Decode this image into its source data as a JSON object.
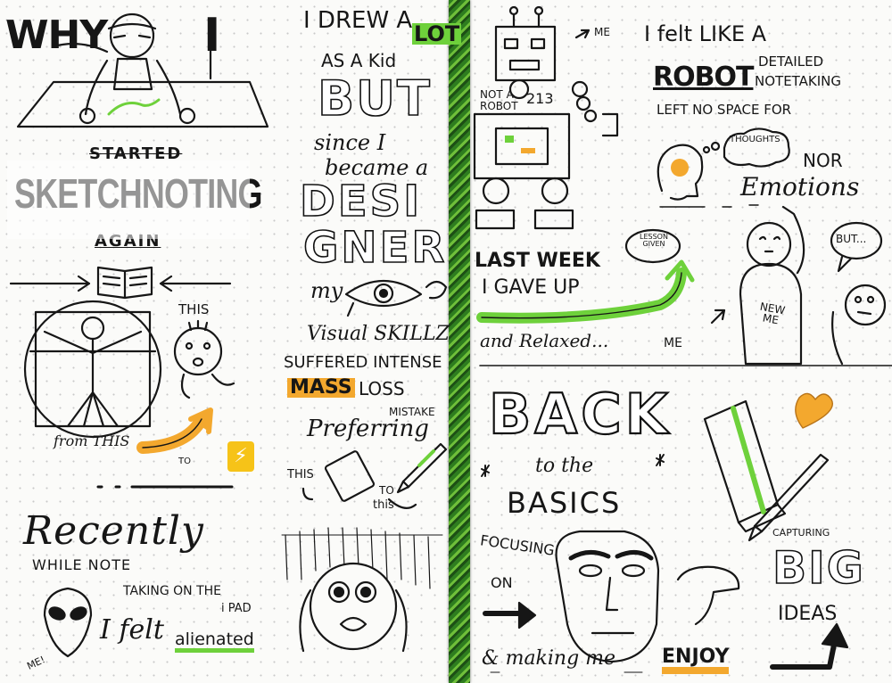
{
  "left_page": {
    "title_why": "WHY",
    "title_i": "I",
    "started": "STARTED",
    "sketchnoting": "SKETCHNOTING",
    "again": "AGAIN",
    "this_label": "THIS",
    "from_this": "from THIS",
    "to_small": "TO",
    "recently": "Recently",
    "while_note": "WHILE NOTE",
    "taking_on_the": "TAKING ON THE",
    "ipad": "i PAD",
    "i_felt": "I felt",
    "alienated": "alienated",
    "me_small": "ME!",
    "i_drew_a": "I DREW A",
    "lot": "LOT",
    "as_a_kid": "AS A Kid",
    "but": "BUT",
    "since_i": "since I",
    "became_a": "became a",
    "desi": "DESI",
    "gner": "GNER",
    "my": "my",
    "visual_skillz": "Visual SKILLZ",
    "suffered_intense": "SUFFERED INTENSE",
    "mass": "MASS",
    "loss": "LOSS",
    "mistake": "MISTAKE",
    "preferring": "Preferring",
    "this_small": "THIS",
    "to_this": "TO",
    "this_end": "this"
  },
  "right_page": {
    "me_label": "ME",
    "not_a_robot": "NOT A",
    "robot_word": "ROBOT",
    "robot_num": "213",
    "i_felt_like_a": "I felt LIKE A",
    "robot": "ROBOT",
    "detailed": "DETAILED",
    "notetaking": "NOTETAKING",
    "left_no_space": "LEFT NO SPACE FOR",
    "thoughts": "THOUGHTS",
    "nor": "NOR",
    "emotions": "Emotions",
    "last_week": "LAST WEEK",
    "i_gave_up": "I GAVE UP",
    "and_relaxed": "and Relaxed...",
    "me2": "ME",
    "lesson_given": "LESSON GIVEN",
    "new_me": "NEW ME",
    "but_bubble": "BUT...",
    "back": "BACK",
    "to_the": "to the",
    "basics": "BASICS",
    "focusing": "FOCUSING",
    "on": "ON",
    "making_me": "& making me",
    "enjoy": "ENJOY",
    "capturing": "CAPTURING",
    "big": "BIG",
    "ideas": "IDEAS"
  },
  "colors": {
    "ink": "#161616",
    "green_marker": "#6ed13b",
    "orange_marker": "#f3a82e",
    "yellow_badge": "#f6c318",
    "lace_green": "#2e7d1f"
  },
  "icons": [
    "open-book-icon",
    "lightning-icon",
    "heart-icon",
    "pen-icon",
    "brain-icon",
    "tablet-icon",
    "alien-icon"
  ]
}
